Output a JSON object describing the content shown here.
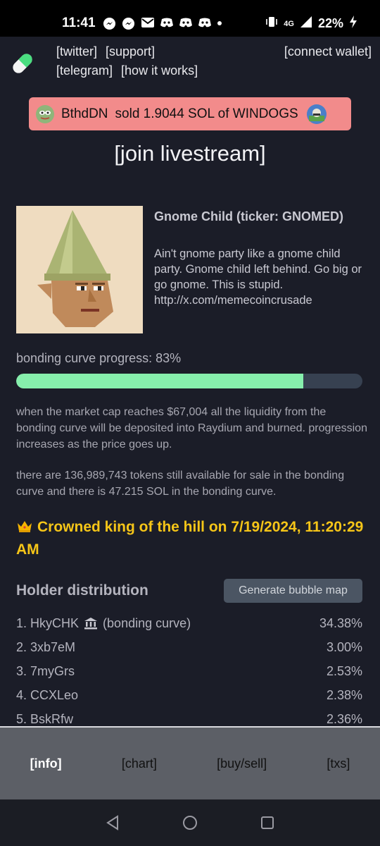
{
  "status_bar": {
    "time": "11:41",
    "network": "4G",
    "battery": "22%"
  },
  "header": {
    "links": [
      "[twitter]",
      "[support]",
      "[telegram]",
      "[how it works]"
    ],
    "connect_wallet": "[connect wallet]"
  },
  "trade_banner": {
    "user": "BthdDN",
    "action": "sold 1.9044 SOL of WINDOGS"
  },
  "livestream_link": "[join livestream]",
  "token": {
    "name": "Gnome Child (ticker: GNOMED)",
    "description": "Ain't gnome party like a gnome child party. Gnome child left behind. Go big or go gnome. This is stupid. http://x.com/memecoincrusade"
  },
  "bonding": {
    "label": "bonding curve progress: 83%",
    "progress": 0.83,
    "note1": "when the market cap reaches $67,004 all the liquidity from the bonding curve will be deposited into Raydium and burned. progression increases as the price goes up.",
    "note2": "there are 136,989,743 tokens still available for sale in the bonding curve and there is 47.215 SOL in the bonding curve."
  },
  "king_of_hill": "Crowned king of the hill on 7/19/2024, 11:20:29 AM",
  "holders": {
    "title": "Holder distribution",
    "bubble_button": "Generate bubble map",
    "rows": [
      {
        "name": "1. HkyCHK",
        "suffix": "(bonding curve)",
        "pct": "34.38%"
      },
      {
        "name": "2. 3xb7eM",
        "suffix": "",
        "pct": "3.00%"
      },
      {
        "name": "3. 7myGrs",
        "suffix": "",
        "pct": "2.53%"
      },
      {
        "name": "4. CCXLeo",
        "suffix": "",
        "pct": "2.38%"
      },
      {
        "name": "5. BskRfw",
        "suffix": "",
        "pct": "2.36%"
      }
    ]
  },
  "bottom_tabs": [
    "[info]",
    "[chart]",
    "[buy/sell]",
    "[txs]"
  ],
  "colors": {
    "background": "#1b1d28",
    "banner": "#f28b8b",
    "progress": "#86efac",
    "king": "#f5c518"
  }
}
